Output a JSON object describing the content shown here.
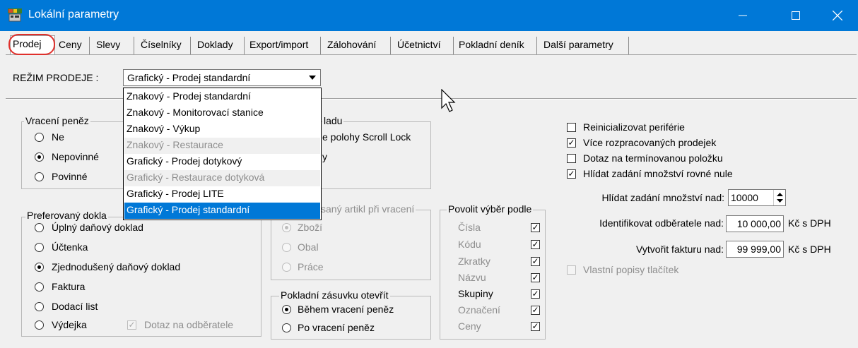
{
  "window": {
    "title": "Lokální parametry",
    "icon": "app-cash-register-icon",
    "buttons": [
      "minimize-icon",
      "maximize-icon",
      "close-icon"
    ]
  },
  "tabs": [
    "Prodej",
    "Ceny",
    "Slevy",
    "Číselníky",
    "Doklady",
    "Export/import",
    "Zálohování",
    "Účetnictví",
    "Pokladní deník",
    "Další parametry"
  ],
  "mode": {
    "label": "REŽIM PRODEJE :",
    "value": "Grafický - Prodej standardní",
    "options": [
      {
        "label": "Znakový - Prodej standardní",
        "state": "normal"
      },
      {
        "label": "Znakový - Monitorovací stanice",
        "state": "normal"
      },
      {
        "label": "Znakový - Výkup",
        "state": "normal"
      },
      {
        "label": "Znakový - Restaurace",
        "state": "disabled"
      },
      {
        "label": "Grafický - Prodej dotykový",
        "state": "normal"
      },
      {
        "label": "Grafický - Restaurace dotyková",
        "state": "disabled"
      },
      {
        "label": "Grafický - Prodej LITE",
        "state": "normal"
      },
      {
        "label": "Grafický - Prodej standardní",
        "state": "selected"
      }
    ]
  },
  "vraceni": {
    "title": "Vracení peněz",
    "items": [
      {
        "label": "Ne",
        "checked": false
      },
      {
        "label": "Nepovinné",
        "checked": true
      },
      {
        "label": "Povinné",
        "checked": false
      }
    ]
  },
  "hidden_group": {
    "title_tail": "ladu",
    "line1_tail": "e polohy Scroll Lock",
    "line2_tail": "y"
  },
  "preferovany": {
    "title": "Preferovaný dokla",
    "items": [
      {
        "label": "Úplný daňový doklad",
        "checked": false
      },
      {
        "label": "Účtenka",
        "checked": false
      },
      {
        "label": "Zjednodušený daňový doklad",
        "checked": true
      },
      {
        "label": "Faktura",
        "checked": false
      },
      {
        "label": "Dodací list",
        "checked": false
      },
      {
        "label": "Výdejka",
        "checked": false
      }
    ],
    "dotaz_label": "Dotaz na odběratele",
    "dotaz_checked": true
  },
  "artikl": {
    "title": "saný artikl při vracení",
    "items": [
      {
        "label": "Zboží",
        "checked": true
      },
      {
        "label": "Obal",
        "checked": false
      },
      {
        "label": "Práce",
        "checked": false
      }
    ]
  },
  "zasuvka": {
    "title": "Pokladní zásuvku otevřít",
    "items": [
      {
        "label": "Během vracení peněz",
        "checked": true
      },
      {
        "label": "Po vracení peněz",
        "checked": false
      }
    ]
  },
  "povolit": {
    "title": "Povolit výběr podle",
    "items": [
      {
        "label": "Čísla",
        "checked": true,
        "enabled": false
      },
      {
        "label": "Kódu",
        "checked": true,
        "enabled": false
      },
      {
        "label": "Zkratky",
        "checked": true,
        "enabled": false
      },
      {
        "label": "Názvu",
        "checked": true,
        "enabled": false
      },
      {
        "label": "Skupiny",
        "checked": true,
        "enabled": true
      },
      {
        "label": "Označení",
        "checked": true,
        "enabled": false
      },
      {
        "label": "Ceny",
        "checked": true,
        "enabled": false
      }
    ]
  },
  "options": [
    {
      "label": "Reinicializovat periférie",
      "checked": false
    },
    {
      "label": "Více rozpracovaných prodejek",
      "checked": true
    },
    {
      "label": "Dotaz na termínovanou položku",
      "checked": false
    },
    {
      "label": "Hlídat zadání množství rovné nule",
      "checked": true
    }
  ],
  "fields": {
    "mnozstvi_label": "Hlídat zadání množství nad:",
    "mnozstvi_value": "10000",
    "odberatel_label": "Identifikovat odběratele nad:",
    "odberatel_value": "10 000,00",
    "faktura_label": "Vytvořit fakturu nad:",
    "faktura_value": "99 999,00",
    "unit": "Kč s DPH"
  },
  "vlastni": {
    "label": "Vlastní popisy tlačítek",
    "checked": false
  },
  "colors": {
    "titlebar": "#0078d7",
    "annotation": "#e0302c",
    "selection": "#0078d7"
  }
}
